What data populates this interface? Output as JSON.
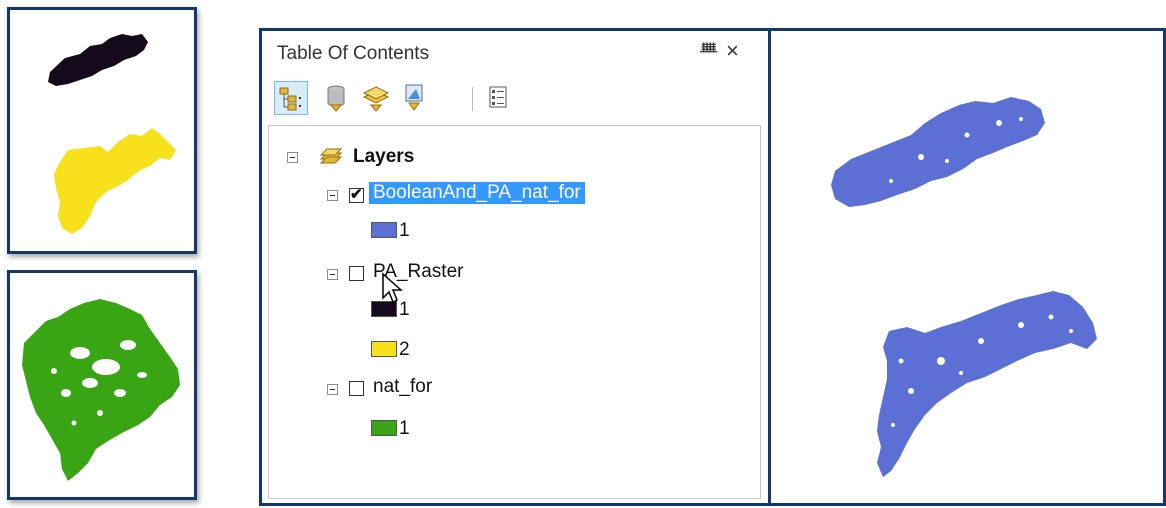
{
  "toc": {
    "title": "Table Of Contents",
    "pin_glyph": "ᚙ",
    "close_glyph": "×",
    "toolbar": [
      {
        "name": "list-by-drawing-order-button",
        "icon": "list-drawing-order-icon",
        "active": true
      },
      {
        "name": "list-by-source-button",
        "icon": "database-icon",
        "active": false
      },
      {
        "name": "list-by-visibility-button",
        "icon": "layers-icon",
        "active": false
      },
      {
        "name": "list-by-selection-button",
        "icon": "selection-layer-icon",
        "active": false
      },
      {
        "name": "options-button",
        "icon": "options-list-icon",
        "active": false
      }
    ],
    "group_label": "Layers",
    "layers": [
      {
        "name": "BooleanAnd_PA_nat_for",
        "checked": true,
        "selected": true,
        "classes": [
          {
            "label": "1",
            "color": "#5b6fd4"
          }
        ]
      },
      {
        "name": "PA_Raster",
        "checked": false,
        "selected": false,
        "classes": [
          {
            "label": "1",
            "color": "#150a1c"
          },
          {
            "label": "2",
            "color": "#f7e01c"
          }
        ]
      },
      {
        "name": "nat_for",
        "checked": false,
        "selected": false,
        "classes": [
          {
            "label": "1",
            "color": "#3aa514"
          }
        ]
      }
    ],
    "check_glyph": "✔"
  },
  "colors": {
    "frame_border": "#13386b",
    "selection": "#3399ff",
    "result_fill": "#5b6fd4",
    "pa_dark": "#150a1c",
    "pa_yellow": "#f7e01c",
    "forest_green": "#3aa514"
  }
}
